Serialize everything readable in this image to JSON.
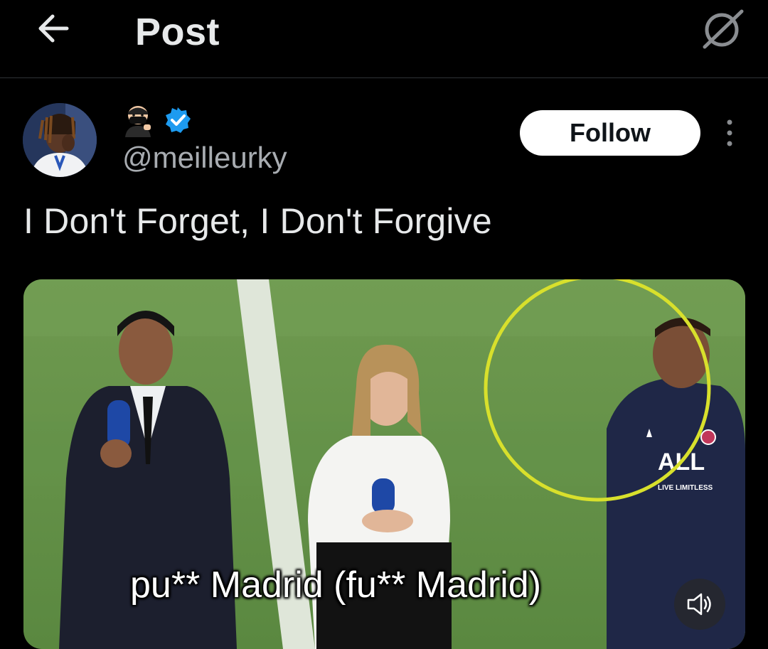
{
  "header": {
    "title": "Post",
    "back_icon": "arrow-left-icon",
    "grok_icon": "grok-icon"
  },
  "author": {
    "display_name_icon": "ninja-emoji-icon",
    "verified_icon": "verified-badge-icon",
    "handle": "@meilleurky",
    "follow_label": "Follow",
    "more_icon": "more-vertical-icon"
  },
  "post": {
    "text": "I Don't Forget, I Don't Forgive"
  },
  "media": {
    "subtitle": "pu** Madrid (fu** Madrid)",
    "volume_icon": "volume-icon",
    "jersey_text": "LIVE LIMITLESS",
    "highlight_color": "#d8e02c"
  },
  "colors": {
    "background": "#000000",
    "text": "#e7e9ea",
    "secondary_text": "#a8acb1",
    "verified": "#1d9bf0",
    "divider": "#2f3336"
  }
}
